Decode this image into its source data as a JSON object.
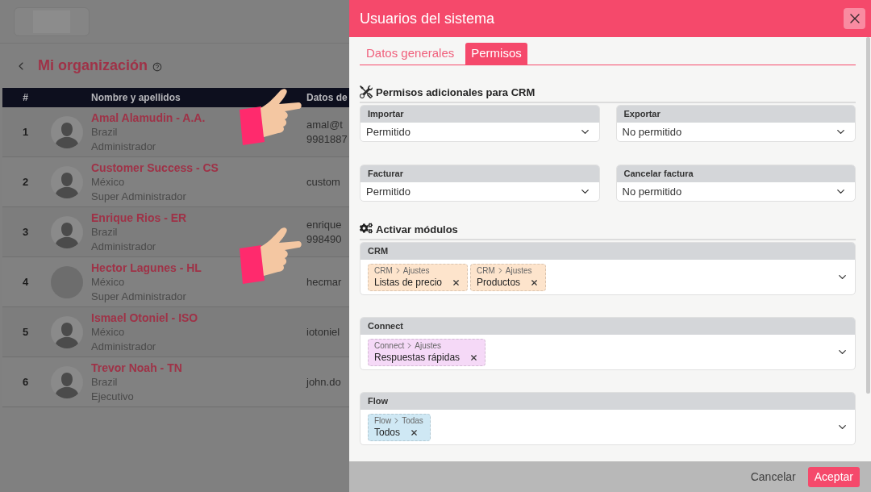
{
  "page": {
    "title": "Mi organización",
    "table": {
      "columns": [
        "#",
        "Nombre y apellidos",
        "Datos de"
      ],
      "rows": [
        {
          "number": "1",
          "name": "Amal Alamudin - A.A.",
          "country": "Brazil",
          "role": "Administrador",
          "avatar": {
            "kind": "silhouette"
          },
          "contact": [
            "amal@t",
            "9981887"
          ]
        },
        {
          "number": "2",
          "name": "Customer Success - CS",
          "country": "México",
          "role": "Super Administrador",
          "avatar": {
            "kind": "silhouette"
          },
          "contact": [
            "custom"
          ]
        },
        {
          "number": "3",
          "name": "Enrique Rios - ER",
          "country": "Brazil",
          "role": "Administrador",
          "avatar": {
            "kind": "silhouette"
          },
          "contact": [
            "enrique",
            "998490"
          ]
        },
        {
          "number": "4",
          "name": "Hector Lagunes - HL",
          "country": "México",
          "role": "Super Administrador",
          "avatar": {
            "kind": "photo"
          },
          "contact": [
            "hecmar"
          ]
        },
        {
          "number": "5",
          "name": "Ismael Otoniel - ISO",
          "country": "México",
          "role": "Administrador",
          "avatar": {
            "kind": "silhouette"
          },
          "contact": [
            "iotoniel"
          ]
        },
        {
          "number": "6",
          "name": "Trevor Noah - TN",
          "country": "Brazil",
          "role": "Ejecutivo",
          "avatar": {
            "kind": "silhouette"
          },
          "contact": [
            "john.do"
          ]
        }
      ]
    }
  },
  "dialog": {
    "title": "Usuarios del sistema",
    "tabs": [
      {
        "label": "Datos generales",
        "selected": false
      },
      {
        "label": "Permisos",
        "selected": true
      }
    ],
    "permissions": {
      "title": "Permisos adicionales para CRM",
      "fields": [
        {
          "label": "Importar",
          "value": "Permitido"
        },
        {
          "label": "Exportar",
          "value": "No permitido"
        },
        {
          "label": "Facturar",
          "value": "Permitido"
        },
        {
          "label": "Cancelar factura",
          "value": "No permitido"
        }
      ]
    },
    "modules": {
      "title": "Activar módulos",
      "groups": [
        {
          "label": "CRM",
          "color": "#fde4cc",
          "chips": [
            {
              "module": "CRM",
              "section": "Ajustes",
              "label": "Listas de precio"
            },
            {
              "module": "CRM",
              "section": "Ajustes",
              "label": "Productos"
            }
          ]
        },
        {
          "label": "Connect",
          "color": "#f5d9f7",
          "chips": [
            {
              "module": "Connect",
              "section": "Ajustes",
              "label": "Respuestas rápidas"
            }
          ]
        },
        {
          "label": "Flow",
          "color": "#cfe8f4",
          "chips": [
            {
              "module": "Flow",
              "section": "Todas",
              "label": "Todos"
            }
          ]
        }
      ]
    },
    "buttons": [
      {
        "label": "Cancelar",
        "kind": "secondary"
      },
      {
        "label": "Aceptar",
        "kind": "primary"
      }
    ]
  }
}
